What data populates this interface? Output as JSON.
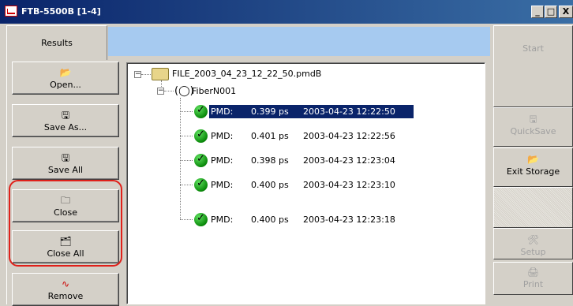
{
  "window": {
    "title": "FTB-5500B [1-4]",
    "min_label": "_",
    "max_label": "□",
    "close_label": "X"
  },
  "tab": {
    "label": "Results"
  },
  "left_buttons": [
    {
      "label": "Open...",
      "icon": "folder-open-icon"
    },
    {
      "label": "Save As...",
      "icon": "floppy-icon"
    },
    {
      "label": "Save All",
      "icon": "floppy-icon"
    },
    {
      "label": "Close",
      "icon": "folder-icon"
    },
    {
      "label": "Close All",
      "icon": "folders-icon"
    },
    {
      "label": "Remove",
      "icon": "curve-icon"
    }
  ],
  "tree": {
    "file": "FILE_2003_04_23_12_22_50.pmdB",
    "fiber": "FiberN001",
    "rows": [
      {
        "type": "PMD:",
        "value": "0.399 ps",
        "date": "2003-04-23 12:22:50",
        "selected": true
      },
      {
        "type": "PMD:",
        "value": "0.401 ps",
        "date": "2003-04-23 12:22:56",
        "selected": false
      },
      {
        "type": "PMD:",
        "value": "0.398 ps",
        "date": "2003-04-23 12:23:04",
        "selected": false
      },
      {
        "type": "PMD:",
        "value": "0.400 ps",
        "date": "2003-04-23 12:23:10",
        "selected": false
      },
      {
        "type": "PMD:",
        "value": "0.400 ps",
        "date": "2003-04-23 12:23:18",
        "selected": false
      }
    ]
  },
  "right_buttons": [
    {
      "label": "Start",
      "icon": "",
      "enabled": false
    },
    {
      "label": "QuickSave",
      "icon": "floppy-icon",
      "enabled": false
    },
    {
      "label": "Exit Storage",
      "icon": "folder-open-icon",
      "enabled": true
    },
    {
      "label": "Setup",
      "icon": "tools-icon",
      "enabled": false
    },
    {
      "label": "Print",
      "icon": "printer-icon",
      "enabled": false
    }
  ],
  "colors": {
    "highlight": "#e0201a",
    "selection": "#0a246a",
    "check": "#0a8a0a",
    "titlebar": "#0a246a"
  }
}
